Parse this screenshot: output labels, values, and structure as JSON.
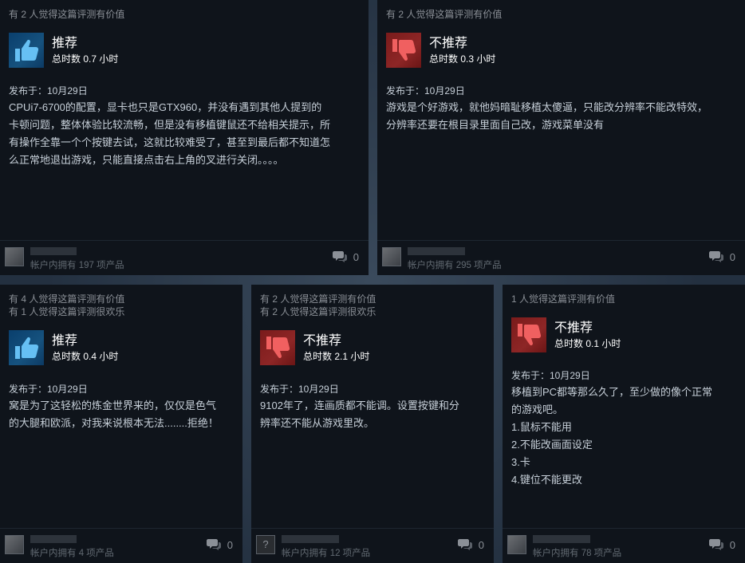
{
  "reviews": [
    {
      "helpful": [
        "有 2 人觉得这篇评测有价值"
      ],
      "verdict": "推荐",
      "sentiment": "up",
      "hours": "总时数 0.7 小时",
      "posted": "发布于：10月29日",
      "body": [
        "CPUi7-6700的配置，显卡也只是GTX960，并没有遇到其他人提到的",
        "卡顿问题，整体体验比较流畅，但是没有移植键鼠还不给相关提示，所",
        "有操作全靠一个个按键去试，这就比较难受了，甚至到最后都不知道怎",
        "么正常地退出游戏，只能直接点击右上角的叉进行关闭。。。。"
      ],
      "owns": "帐户内拥有 197 项产品",
      "comments": "0",
      "avatar": "pic"
    },
    {
      "helpful": [
        "有 2 人觉得这篇评测有价值"
      ],
      "verdict": "不推荐",
      "sentiment": "down",
      "hours": "总时数 0.3 小时",
      "posted": "发布于：10月29日",
      "body": [
        "游戏是个好游戏，就他妈暗耻移植太傻逼，只能改分辨率不能改特效，",
        "分辨率还要在根目录里面自己改，游戏菜单没有"
      ],
      "owns": "帐户内拥有 295 项产品",
      "comments": "0",
      "avatar": "pic"
    },
    {
      "helpful": [
        "有 4 人觉得这篇评测有价值",
        "有 1 人觉得这篇评测很欢乐"
      ],
      "verdict": "推荐",
      "sentiment": "up",
      "hours": "总时数 0.4 小时",
      "posted": "发布于：10月29日",
      "body": [
        "窝是为了这轻松的炼金世界来的，仅仅是色气",
        "的大腿和欧派，对我来说根本无法........拒绝！"
      ],
      "owns": "帐户内拥有 4 项产品",
      "comments": "0",
      "avatar": "pic"
    },
    {
      "helpful": [
        "有 2 人觉得这篇评测有价值",
        "有 2 人觉得这篇评测很欢乐"
      ],
      "verdict": "不推荐",
      "sentiment": "down",
      "hours": "总时数 2.1 小时",
      "posted": "发布于：10月29日",
      "body": [
        "9102年了，连画质都不能调。设置按键和分",
        "辨率还不能从游戏里改。"
      ],
      "owns": "帐户内拥有 12 项产品",
      "comments": "0",
      "avatar": "q"
    },
    {
      "helpful": [
        "1 人觉得这篇评测有价值"
      ],
      "verdict": "不推荐",
      "sentiment": "down",
      "hours": "总时数 0.1 小时",
      "posted": "发布于：10月29日",
      "body": [
        "移植到PC都等那么久了，至少做的像个正常",
        "的游戏吧。",
        "1.鼠标不能用",
        "2.不能改画面设定",
        "3.卡",
        "4.键位不能更改"
      ],
      "owns": "帐户内拥有 78 项产品",
      "comments": "0",
      "avatar": "pic"
    }
  ],
  "avatar_placeholder": "?",
  "colors": {
    "card_bg": "#0f141b",
    "recommend_bg": "#16527e",
    "not_recommend_bg": "#8d2626",
    "text_primary": "#ffffff",
    "text_body": "#c6cfd8",
    "text_muted": "#8b9097"
  }
}
